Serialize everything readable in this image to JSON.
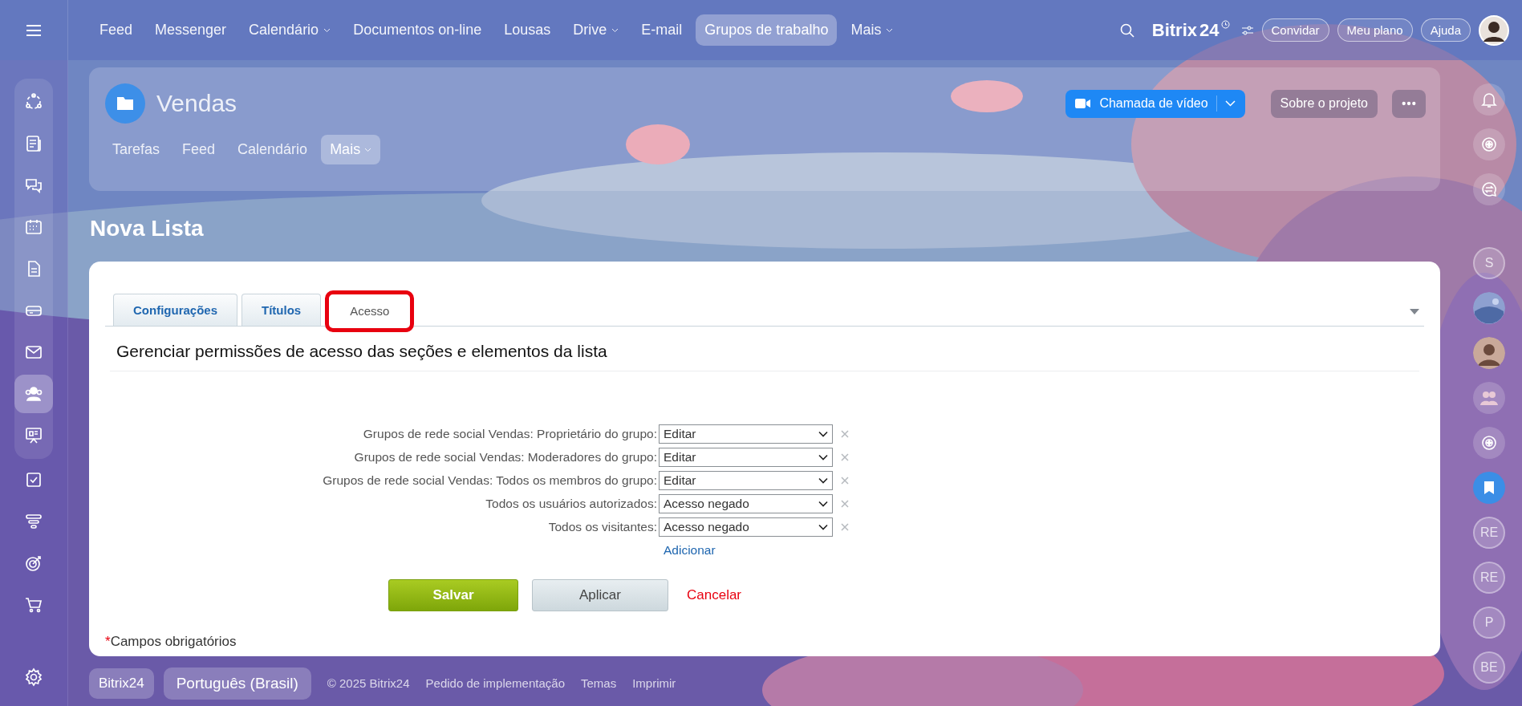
{
  "top_nav": {
    "items": [
      {
        "label": "Feed",
        "dropdown": false,
        "selected": false
      },
      {
        "label": "Messenger",
        "dropdown": false,
        "selected": false
      },
      {
        "label": "Calendário",
        "dropdown": true,
        "selected": false
      },
      {
        "label": "Documentos on-line",
        "dropdown": false,
        "selected": false
      },
      {
        "label": "Lousas",
        "dropdown": false,
        "selected": false
      },
      {
        "label": "Drive",
        "dropdown": true,
        "selected": false
      },
      {
        "label": "E-mail",
        "dropdown": false,
        "selected": false
      },
      {
        "label": "Grupos de trabalho",
        "dropdown": false,
        "selected": true
      },
      {
        "label": "Mais",
        "dropdown": true,
        "selected": false
      }
    ],
    "logo": "Bitrix",
    "logo_number": "24",
    "buttons": [
      "Convidar",
      "Meu plano",
      "Ajuda"
    ]
  },
  "left_sidebar": {
    "items": [
      {
        "selected": false
      },
      {
        "selected": false
      },
      {
        "selected": false
      },
      {
        "selected": false
      },
      {
        "selected": false
      },
      {
        "selected": false
      },
      {
        "selected": false
      },
      {
        "selected": true
      },
      {
        "selected": false
      },
      {
        "selected": false
      },
      {
        "selected": false
      },
      {
        "selected": false
      },
      {
        "selected": false
      }
    ]
  },
  "project": {
    "title": "Vendas",
    "tabs": [
      {
        "label": "Tarefas",
        "selected": false,
        "dropdown": false
      },
      {
        "label": "Feed",
        "selected": false,
        "dropdown": false
      },
      {
        "label": "Calendário",
        "selected": false,
        "dropdown": false
      },
      {
        "label": "Mais",
        "selected": true,
        "dropdown": true
      }
    ],
    "video_call": "Chamada de vídeo",
    "about": "Sobre o projeto"
  },
  "page_title": "Nova Lista",
  "form": {
    "tabs": [
      {
        "label": "Configurações",
        "selected": false,
        "highlighted": false
      },
      {
        "label": "Títulos",
        "selected": false,
        "highlighted": false
      },
      {
        "label": "Acesso",
        "selected": true,
        "highlighted": true
      }
    ],
    "heading": "Gerenciar permissões de acesso das seções e elementos da lista",
    "permissions": [
      {
        "label": "Grupos de rede social Vendas: Proprietário do grupo:",
        "value": "Editar"
      },
      {
        "label": "Grupos de rede social Vendas: Moderadores do grupo:",
        "value": "Editar"
      },
      {
        "label": "Grupos de rede social Vendas: Todos os membros do grupo:",
        "value": "Editar"
      },
      {
        "label": "Todos os usuários autorizados:",
        "value": "Acesso negado"
      },
      {
        "label": "Todos os visitantes:",
        "value": "Acesso negado"
      }
    ],
    "add_link": "Adicionar",
    "save": "Salvar",
    "apply": "Aplicar",
    "cancel": "Cancelar",
    "required_mark": "*",
    "required_note": "Campos obrigatórios"
  },
  "right_sidebar": {
    "items": [
      {
        "kind": "bell"
      },
      {
        "kind": "swirl"
      },
      {
        "kind": "chat"
      },
      {
        "kind": "initials",
        "text": "S"
      },
      {
        "kind": "picture"
      },
      {
        "kind": "person"
      },
      {
        "kind": "group"
      },
      {
        "kind": "swirl"
      },
      {
        "kind": "bookmark"
      },
      {
        "kind": "initials",
        "text": "RE"
      },
      {
        "kind": "initials",
        "text": "RE"
      },
      {
        "kind": "initials",
        "text": "P"
      },
      {
        "kind": "initials",
        "text": "BE"
      }
    ]
  },
  "footer": {
    "logo": "Bitrix24",
    "language": "Português (Brasil)",
    "links": [
      "© 2025 Bitrix24",
      "Pedido de implementação",
      "Temas",
      "Imprimir"
    ]
  }
}
